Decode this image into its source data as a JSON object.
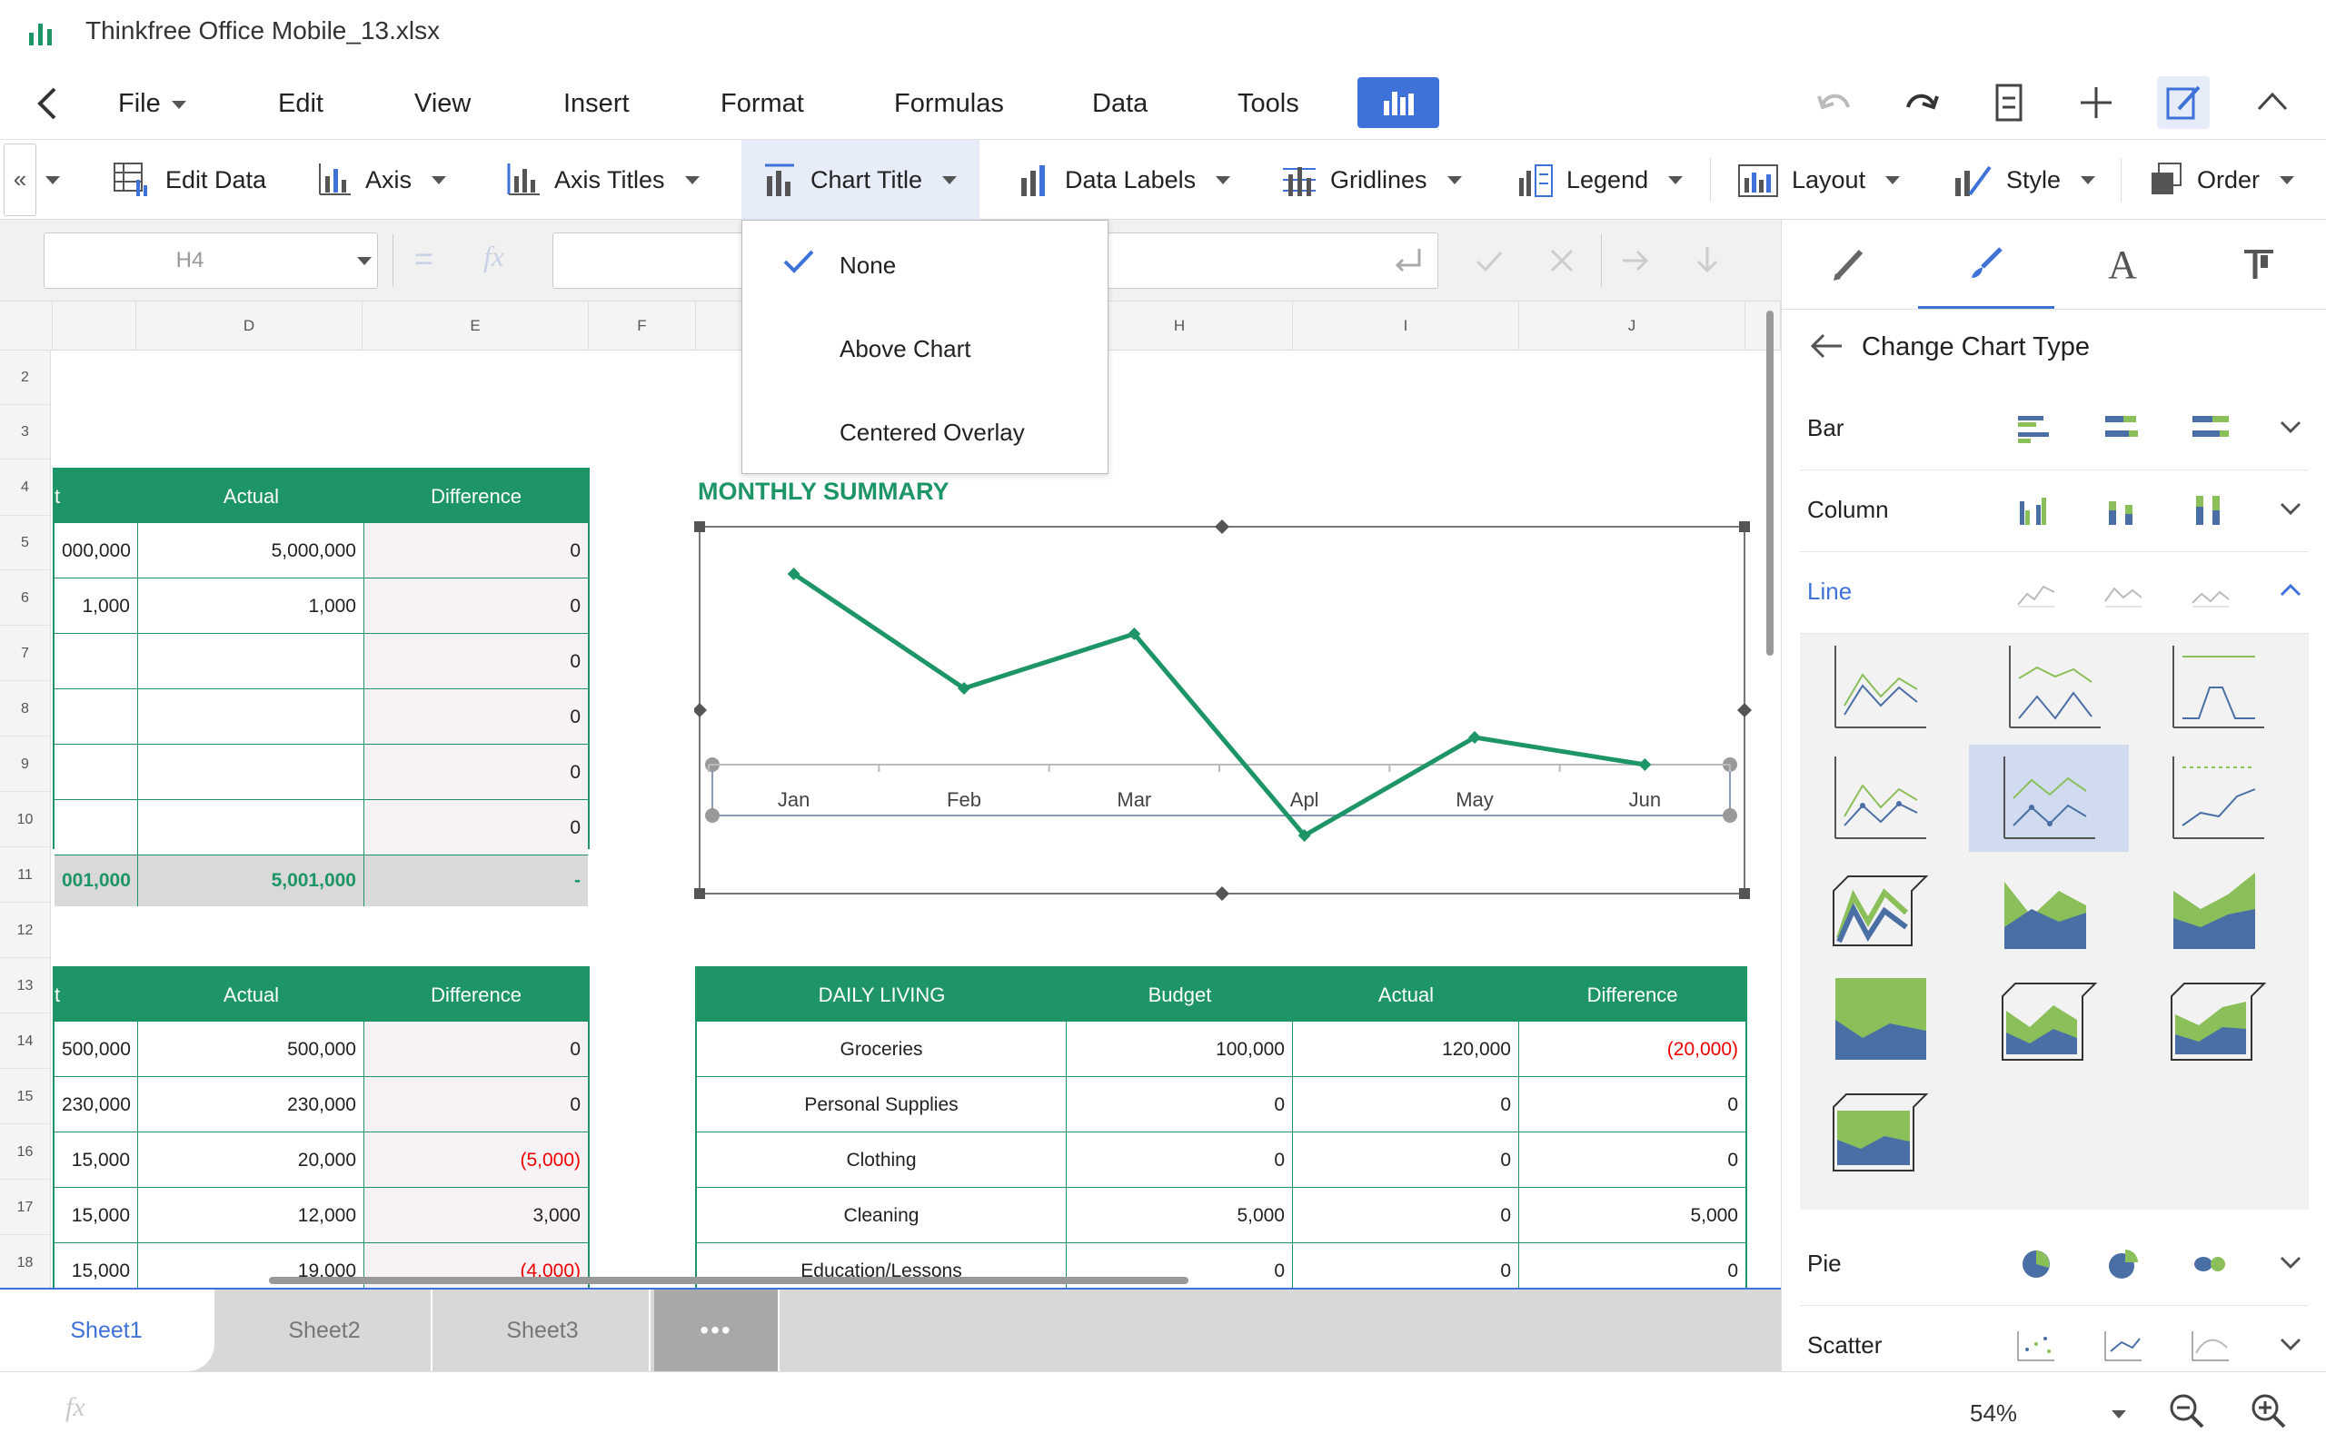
{
  "app": {
    "file_name": "Thinkfree Office Mobile_13.xlsx"
  },
  "menu": {
    "items": [
      "File",
      "Edit",
      "View",
      "Insert",
      "Format",
      "Formulas",
      "Data",
      "Tools"
    ]
  },
  "chart_toolbar": {
    "items": [
      "Edit Data",
      "Axis",
      "Axis Titles",
      "Chart Title",
      "Data Labels",
      "Gridlines",
      "Legend",
      "Layout",
      "Style",
      "Order"
    ]
  },
  "formula_bar": {
    "cell_ref": "H4",
    "value": ""
  },
  "columns": [
    "D",
    "E",
    "F",
    "H",
    "I",
    "J"
  ],
  "rows": [
    "2",
    "3",
    "4",
    "5",
    "6",
    "7",
    "8",
    "9",
    "10",
    "11",
    "12",
    "13",
    "14",
    "15",
    "16",
    "17",
    "18"
  ],
  "table1": {
    "header": [
      "t",
      "Actual",
      "Difference"
    ],
    "rows": [
      [
        "000,000",
        "5,000,000",
        "0"
      ],
      [
        "1,000",
        "1,000",
        "0"
      ],
      [
        "",
        "",
        "0"
      ],
      [
        "",
        "",
        "0"
      ],
      [
        "",
        "",
        "0"
      ],
      [
        "",
        "",
        "0"
      ]
    ],
    "total": [
      "001,000",
      "5,001,000",
      "-"
    ]
  },
  "table2": {
    "header": [
      "t",
      "Actual",
      "Difference"
    ],
    "rows": [
      [
        "500,000",
        "500,000",
        "0"
      ],
      [
        "230,000",
        "230,000",
        "0"
      ],
      [
        "15,000",
        "20,000",
        "(5,000)"
      ],
      [
        "15,000",
        "12,000",
        "3,000"
      ],
      [
        "15,000",
        "19,000",
        "(4,000)"
      ]
    ]
  },
  "table3": {
    "header": [
      "DAILY LIVING",
      "Budget",
      "Actual",
      "Difference"
    ],
    "rows": [
      [
        "Groceries",
        "100,000",
        "120,000",
        "(20,000)"
      ],
      [
        "Personal Supplies",
        "0",
        "0",
        "0"
      ],
      [
        "Clothing",
        "0",
        "0",
        "0"
      ],
      [
        "Cleaning",
        "5,000",
        "0",
        "5,000"
      ],
      [
        "Education/Lessons",
        "0",
        "0",
        "0"
      ]
    ]
  },
  "chart_data": {
    "type": "line",
    "title": "MONTHLY SUMMARY",
    "categories": [
      "Jan",
      "Feb",
      "Mar",
      "Apl",
      "May",
      "Jun"
    ],
    "series": [
      {
        "values": [
          3.5,
          1.4,
          2.4,
          -1.3,
          0.5,
          0
        ]
      }
    ],
    "color": "#1e9566"
  },
  "dropdown": {
    "options": [
      "None",
      "Above Chart",
      "Centered Overlay"
    ],
    "selected": "None"
  },
  "panel": {
    "title": "Change Chart Type",
    "types": [
      "Bar",
      "Column",
      "Line",
      "Pie",
      "Scatter"
    ],
    "active_type": "Line"
  },
  "sheets": [
    "Sheet1",
    "Sheet2",
    "Sheet3"
  ],
  "more_sheets": "•••",
  "zoom": "54%",
  "colors": {
    "accent": "#3f72d8",
    "green": "#1e9566",
    "negative": "#e00000"
  }
}
